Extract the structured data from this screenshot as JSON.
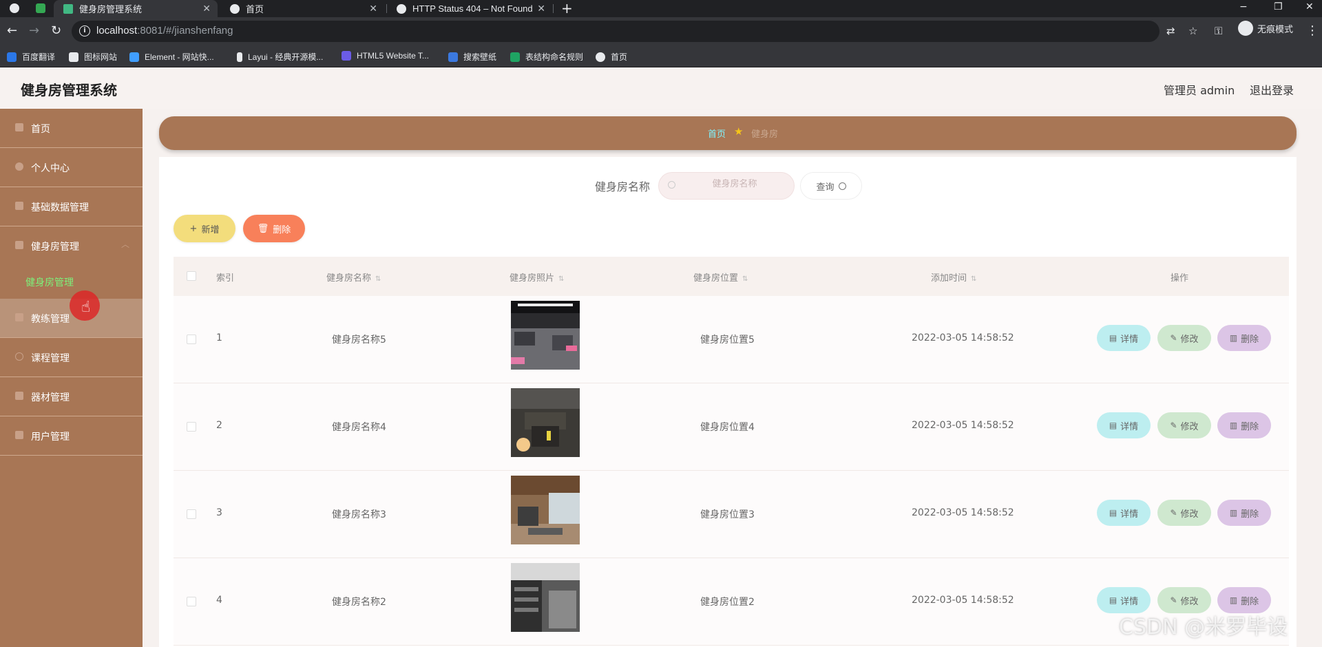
{
  "browser": {
    "tabs": [
      {
        "title": "健身房管理系统",
        "active": true
      },
      {
        "title": "首页",
        "active": false
      },
      {
        "title": "HTTP Status 404 – Not Found",
        "active": false
      }
    ],
    "url_host": "localhost",
    "url_path": ":8081/#/jianshenfang",
    "profile_label": "无痕模式",
    "bookmarks": [
      "百度翻译",
      "图标网站",
      "Element - 网站快...",
      "Layui - 经典开源模...",
      "HTML5 Website T...",
      "搜索壁纸",
      "表结构命名规则",
      "首页"
    ]
  },
  "header": {
    "title": "健身房管理系统",
    "user": "管理员 admin",
    "logout": "退出登录"
  },
  "sidebar": {
    "items": [
      {
        "label": "首页"
      },
      {
        "label": "个人中心"
      },
      {
        "label": "基础数据管理"
      },
      {
        "label": "健身房管理",
        "expanded": true,
        "children": [
          {
            "label": "健身房管理",
            "active": true
          }
        ]
      },
      {
        "label": "教练管理"
      },
      {
        "label": "课程管理"
      },
      {
        "label": "器材管理"
      },
      {
        "label": "用户管理"
      }
    ]
  },
  "breadcrumb": {
    "home": "首页",
    "current": "健身房"
  },
  "search": {
    "label": "健身房名称",
    "placeholder": "健身房名称",
    "button": "查询"
  },
  "actions": {
    "add": "新增",
    "delete": "删除"
  },
  "table": {
    "columns": [
      "索引",
      "健身房名称",
      "健身房照片",
      "健身房位置",
      "添加时间",
      "操作"
    ],
    "rows": [
      {
        "index": "1",
        "name": "健身房名称5",
        "location": "健身房位置5",
        "time": "2022-03-05 14:58:52"
      },
      {
        "index": "2",
        "name": "健身房名称4",
        "location": "健身房位置4",
        "time": "2022-03-05 14:58:52"
      },
      {
        "index": "3",
        "name": "健身房名称3",
        "location": "健身房位置3",
        "time": "2022-03-05 14:58:52"
      },
      {
        "index": "4",
        "name": "健身房名称2",
        "location": "健身房位置2",
        "time": "2022-03-05 14:58:52"
      }
    ],
    "row_buttons": {
      "detail": "详情",
      "edit": "修改",
      "delete": "删除"
    }
  },
  "watermark": "CSDN @米罗毕设",
  "colors": {
    "sidebar": "#a87655",
    "active_sub": "#7df07a",
    "add_btn": "#f3dd7c",
    "del_btn": "#f8805a"
  }
}
